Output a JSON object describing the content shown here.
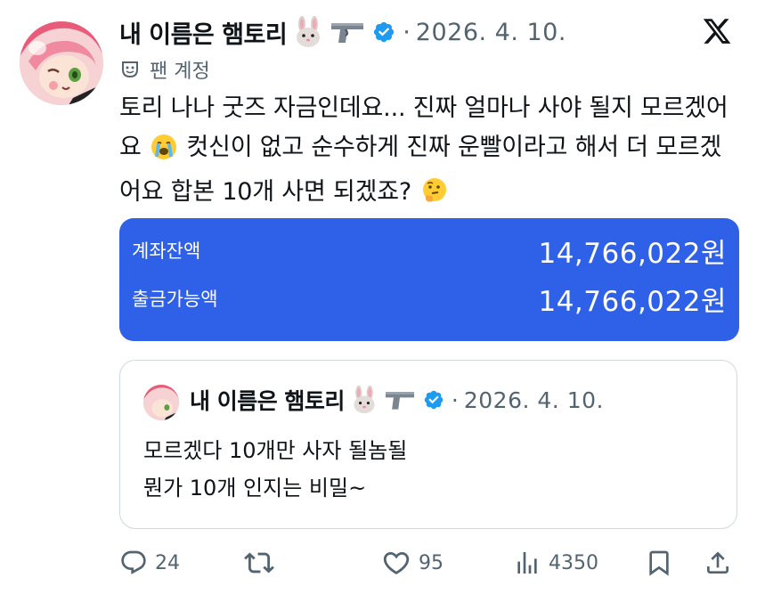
{
  "author": {
    "display_name": "내 이름은 햄토리",
    "date": "2026. 4. 10.",
    "separator": "·",
    "emojis": [
      "rabbit-emoji",
      "pistol-emoji"
    ],
    "verified": true,
    "badge_color": "#1d9bf0"
  },
  "fan_label": "팬 계정",
  "post": {
    "text_part1": "토리 나나 굿즈 자금인데요... 진짜 얼마나 사야 될지 모르겠어요",
    "text_part2": " 컷신이 없고 순수하게 진짜 운빨이라고 해서 더 모르겠어요 합본 10개 사면 되겠죠?",
    "emoji1": "crying-emoji",
    "emoji2": "thinking-emoji"
  },
  "bank_card": {
    "row1_label": "계좌잔액",
    "row1_value": "14,766,022원",
    "row2_label": "출금가능액",
    "row2_value": "14,766,022원",
    "background_color": "#2f60e8"
  },
  "quoted_post": {
    "display_name": "내 이름은 햄토리",
    "date": "2026. 4. 10.",
    "separator": "·",
    "line1": "모르겠다 10개만 사자 될놈될",
    "line2": "뭔가 10개 인지는 비밀~"
  },
  "actions": {
    "reply_count": "24",
    "retweet_count": "",
    "like_count": "95",
    "view_count": "4350"
  },
  "colors": {
    "text": "#0f1419",
    "secondary": "#536471",
    "border": "#cfd9de"
  }
}
